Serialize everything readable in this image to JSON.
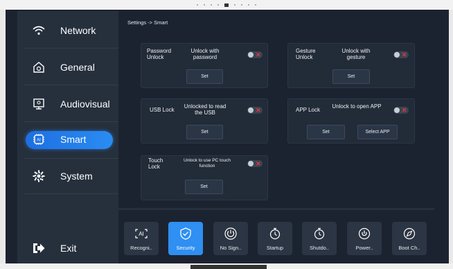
{
  "breadcrumb": "Settings -> Smart",
  "sidebar": {
    "items": [
      {
        "label": "Network",
        "icon": "wifi-icon"
      },
      {
        "label": "General",
        "icon": "house-icon"
      },
      {
        "label": "Audiovisual",
        "icon": "monitor-icon"
      },
      {
        "label": "Smart",
        "icon": "ai-chip-icon",
        "active": true
      },
      {
        "label": "System",
        "icon": "gear-icon"
      }
    ],
    "exit": {
      "label": "Exit",
      "icon": "exit-arrow-icon"
    }
  },
  "cards": {
    "password": {
      "label": "Password Unlock",
      "desc": "Unlock with password",
      "toggle": "off",
      "button": "Set"
    },
    "gesture": {
      "label": "Gesture Unlock",
      "desc": "Unlock with gesture",
      "toggle": "off",
      "button": "Set"
    },
    "usb": {
      "label": "USB Lock",
      "desc": "Unlocked to read the USB",
      "toggle": "off",
      "button": "Set"
    },
    "app": {
      "label": "APP Lock",
      "desc": "Unlock to open APP",
      "toggle": "off",
      "button": "Set",
      "button2": "Select APP"
    },
    "touch": {
      "label": "Touch Lock",
      "desc": "Unlock to use PC touch function",
      "toggle": "off",
      "button": "Set"
    }
  },
  "dock": [
    {
      "label": "Recogni..",
      "icon": "ai-scan-icon"
    },
    {
      "label": "Security",
      "icon": "shield-check-icon",
      "active": true
    },
    {
      "label": "No Sign..",
      "icon": "power-ring-icon"
    },
    {
      "label": "Startup",
      "icon": "timer-icon"
    },
    {
      "label": "Shutdo..",
      "icon": "timer-icon"
    },
    {
      "label": "Power..",
      "icon": "power-button-icon"
    },
    {
      "label": "Boot Ch..",
      "icon": "compass-icon"
    }
  ],
  "colors": {
    "accent": "#2f8ff2",
    "toggle_off_x": "#e5363e",
    "background": "#1c2330"
  }
}
